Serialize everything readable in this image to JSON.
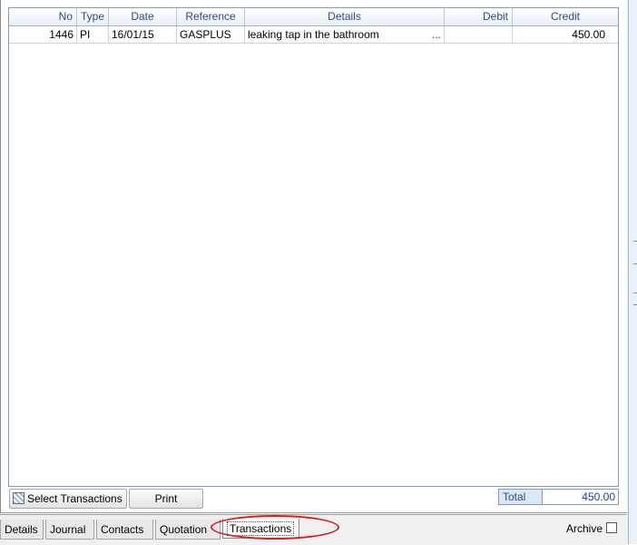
{
  "table": {
    "columns": {
      "no": "No",
      "type": "Type",
      "date": "Date",
      "reference": "Reference",
      "details": "Details",
      "debit": "Debit",
      "credit": "Credit"
    },
    "rows": [
      {
        "no": "1446",
        "type": "PI",
        "date": "16/01/15",
        "reference": "GASPLUS",
        "details": "leaking tap in the bathroom",
        "more": "...",
        "debit": "",
        "credit": "450.00"
      }
    ]
  },
  "buttons": {
    "select_transactions": "Select Transactions",
    "print": "Print"
  },
  "total": {
    "label": "Total",
    "value": "450.00"
  },
  "tabs": {
    "details": "Details",
    "journal": "Journal",
    "contacts": "Contacts",
    "quotation": "Quotation",
    "transactions": "Transactions",
    "active": "Transactions"
  },
  "archive": {
    "label": "Archive",
    "checked": false
  },
  "colors": {
    "header_text": "#2a4e8a",
    "total_value": "#1a3fb0",
    "highlight_ellipse": "#d62020"
  },
  "icons": {
    "select_transactions": "select-transactions-icon"
  }
}
